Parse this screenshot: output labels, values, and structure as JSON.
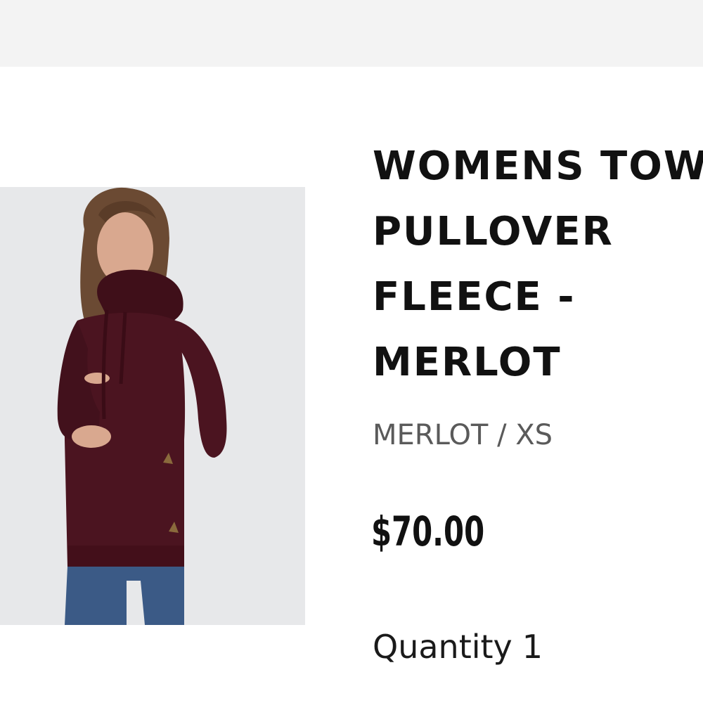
{
  "product": {
    "title_lines": [
      "WOMENS TOWER",
      "PULLOVER",
      "FLEECE -",
      "MERLOT"
    ],
    "variant": "MERLOT / XS",
    "price": "$70.00",
    "quantity_label": "Quantity",
    "quantity_value": "1",
    "image": {
      "subject": "model-wearing-merlot-hoodie",
      "colors": {
        "background": "#e7e8ea",
        "hoodie": "#4b1420",
        "skin": "#d9a88f",
        "hair": "#6b4a33",
        "jeans": "#3b5a86",
        "toggle": "#8a6a3c"
      }
    }
  },
  "colors": {
    "top_bar": "#f3f3f3",
    "text_primary": "#111111",
    "text_secondary": "#5a5a5a"
  }
}
